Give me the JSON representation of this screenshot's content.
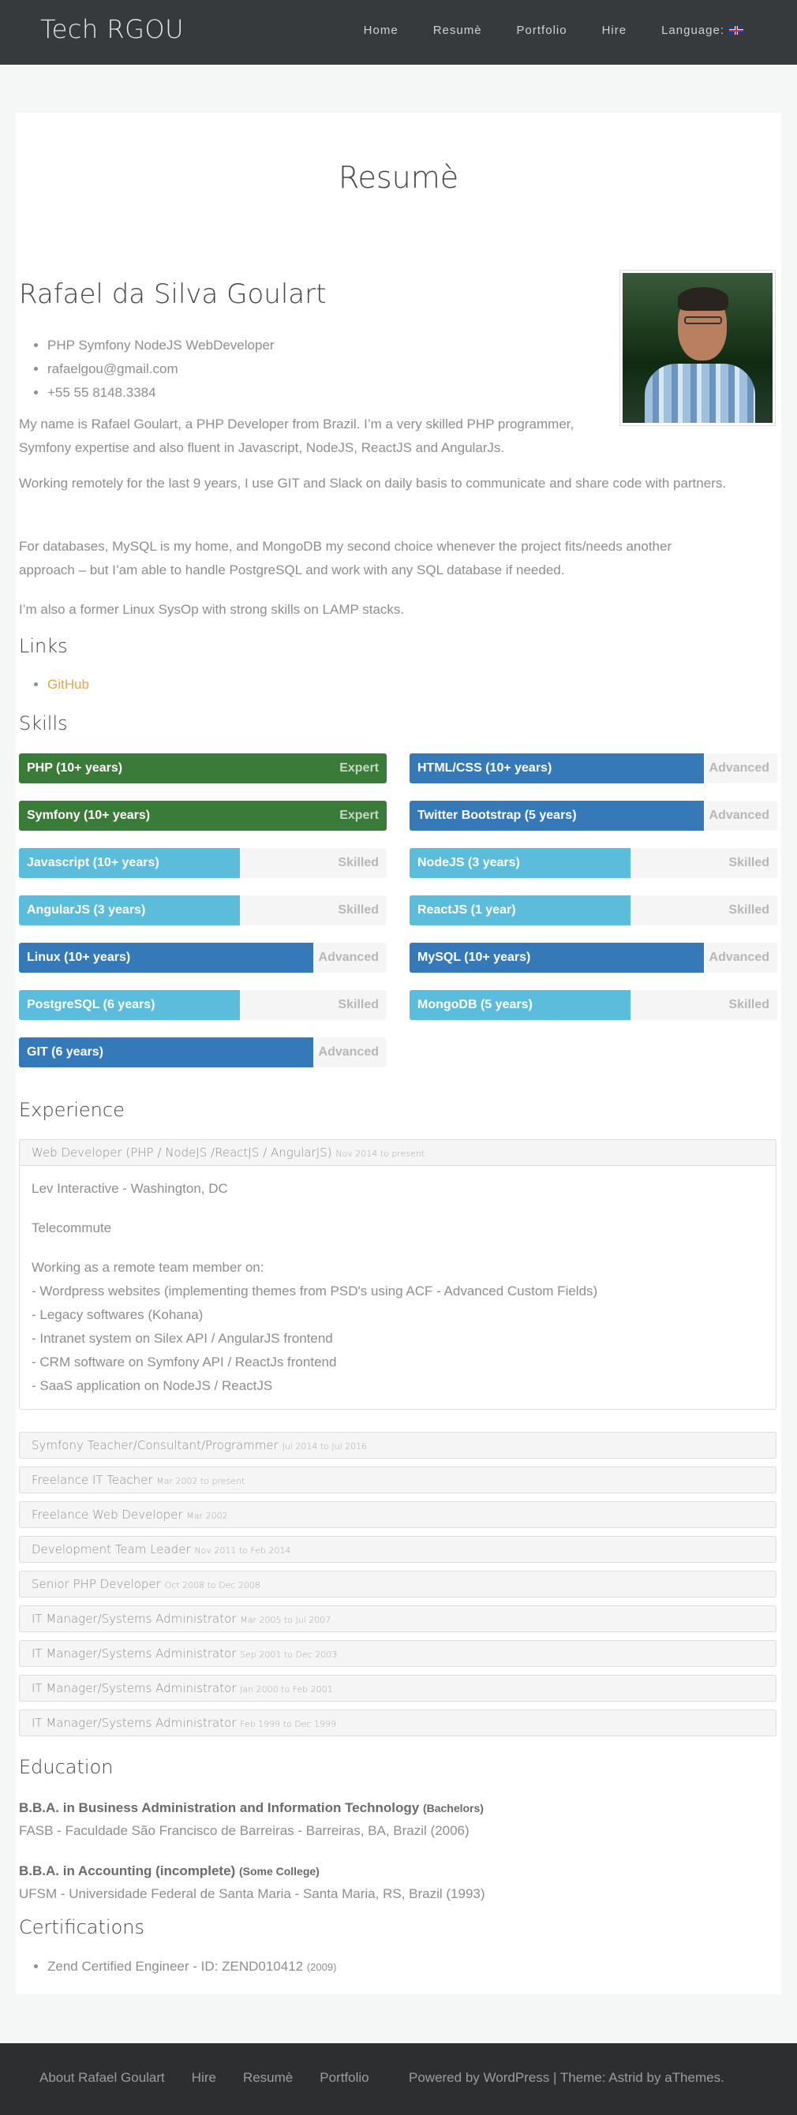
{
  "header": {
    "site_title": "Tech RGOU",
    "nav": [
      "Home",
      "Resumè",
      "Portfolio",
      "Hire",
      "Language:"
    ]
  },
  "page": {
    "title": "Resumè",
    "name": "Rafael da Silva Goulart",
    "info": [
      "PHP Symfony NodeJS WebDeveloper",
      "rafaelgou@gmail.com",
      "+55 55 8148.3384"
    ],
    "paragraphs": [
      "My name is Rafael Goulart, a PHP Developer from Brazil. I’m a very skilled PHP programmer, Symfony expertise and also fluent in Javascript, NodeJS, ReactJS and AngularJs.",
      "Working remotely for the last 9 years, I use GIT and Slack on daily basis to communicate and share code with partners.",
      "For databases, MySQL is my home, and MongoDB my second choice whenever the project fits/needs another approach – but I’am able to handle PostgreSQL and work with any SQL database if needed.",
      "I’m also a former Linux SysOp with strong skills on LAMP stacks."
    ],
    "links_heading": "Links",
    "links": [
      "GitHub"
    ],
    "skills_heading": "Skills",
    "skills": [
      {
        "label": "PHP (10+ years)",
        "level": "Expert",
        "fraction": 1.0,
        "color": "#3a7b3a"
      },
      {
        "label": "HTML/CSS (10+ years)",
        "level": "Advanced",
        "fraction": 0.8,
        "color": "#3579b8"
      },
      {
        "label": "Symfony (10+ years)",
        "level": "Expert",
        "fraction": 1.0,
        "color": "#3a7b3a"
      },
      {
        "label": "Twitter Bootstrap (5 years)",
        "level": "Advanced",
        "fraction": 0.8,
        "color": "#3579b8"
      },
      {
        "label": "Javascript (10+ years)",
        "level": "Skilled",
        "fraction": 0.6,
        "color": "#5bbcdc"
      },
      {
        "label": "NodeJS (3 years)",
        "level": "Skilled",
        "fraction": 0.6,
        "color": "#5bbcdc"
      },
      {
        "label": "AngularJS (3 years)",
        "level": "Skilled",
        "fraction": 0.6,
        "color": "#5bbcdc"
      },
      {
        "label": "ReactJS (1 year)",
        "level": "Skilled",
        "fraction": 0.6,
        "color": "#5bbcdc"
      },
      {
        "label": "Linux (10+ years)",
        "level": "Advanced",
        "fraction": 0.8,
        "color": "#3579b8"
      },
      {
        "label": "MySQL (10+ years)",
        "level": "Advanced",
        "fraction": 0.8,
        "color": "#3579b8"
      },
      {
        "label": "PostgreSQL (6 years)",
        "level": "Skilled",
        "fraction": 0.6,
        "color": "#5bbcdc"
      },
      {
        "label": "MongoDB (5 years)",
        "level": "Skilled",
        "fraction": 0.6,
        "color": "#5bbcdc"
      },
      {
        "label": "GIT (6 years)",
        "level": "Advanced",
        "fraction": 0.8,
        "color": "#3579b8"
      }
    ],
    "experience_heading": "Experience",
    "experience": [
      {
        "title": "Web Developer (PHP / NodeJS /ReactJS / AngularJS)",
        "dates": "Nov 2014 to present",
        "expanded": true,
        "company": "Lev Interactive - Washington, DC",
        "mode": "Telecommute",
        "details": [
          "Working as a remote team member on:",
          "- Wordpress websites (implementing themes from PSD's using ACF - Advanced Custom Fields)",
          "- Legacy softwares (Kohana)",
          "- Intranet system on Silex API / AngularJS frontend",
          "- CRM software on Symfony API / ReactJs frontend",
          "- SaaS application on NodeJS / ReactJS"
        ]
      },
      {
        "title": "Symfony Teacher/Consultant/Programmer",
        "dates": "Jul 2014 to Jul 2016"
      },
      {
        "title": "Freelance IT Teacher",
        "dates": "Mar 2002 to present"
      },
      {
        "title": "Freelance Web Developer",
        "dates": "Mar 2002"
      },
      {
        "title": "Development Team Leader",
        "dates": "Nov 2011 to Feb 2014"
      },
      {
        "title": "Senior PHP Developer",
        "dates": "Oct 2008 to Dec 2008"
      },
      {
        "title": "IT Manager/Systems Administrator",
        "dates": "Mar 2005 to Jul 2007"
      },
      {
        "title": "IT Manager/Systems Administrator",
        "dates": "Sep 2001 to Dec 2003"
      },
      {
        "title": "IT Manager/Systems Administrator",
        "dates": "Jan 2000 to Feb 2001"
      },
      {
        "title": "IT Manager/Systems Administrator",
        "dates": "Feb 1999 to Dec 1999"
      }
    ],
    "education_heading": "Education",
    "education": [
      {
        "degree": "B.B.A. in Business Administration and Information Technology",
        "type": "(Bachelors)",
        "school": "FASB - Faculdade São Francisco de Barreiras - Barreiras, BA, Brazil (2006)"
      },
      {
        "degree": "B.B.A. in Accounting (incomplete)",
        "type": "(Some College)",
        "school": "UFSM - Universidade Federal de Santa Maria - Santa Maria, RS, Brazil (1993)"
      }
    ],
    "certifications_heading": "Certifications",
    "certifications": [
      {
        "name": "Zend Certified Engineer - ID: ZEND010412",
        "year": "(2009)"
      }
    ]
  },
  "footer": {
    "nav": [
      "About Rafael Goulart",
      "Hire",
      "Resumè",
      "Portfolio"
    ],
    "credit_prefix": "Powered by",
    "credit_wp": "WordPress",
    "credit_sep": "|",
    "credit_theme": "Theme:",
    "credit_astrid": "Astrid",
    "credit_by": "by",
    "credit_athemes": "aThemes."
  },
  "colors": {
    "header_bg": "#373a3d",
    "footer_bg": "#2c2e30",
    "link": "#f0a143",
    "expert": "#3a7b3a",
    "advanced": "#3579b8",
    "skilled": "#5bbcdc"
  }
}
